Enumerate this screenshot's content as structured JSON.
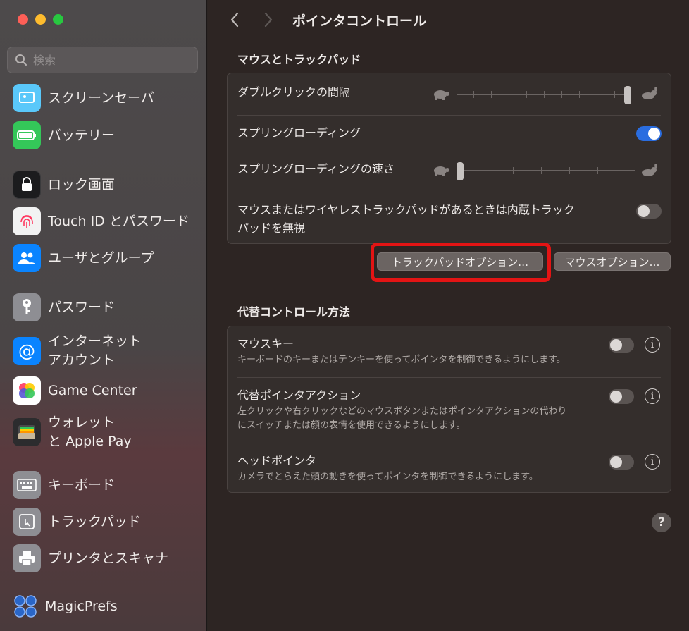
{
  "window": {
    "title": "ポインタコントロール"
  },
  "sidebar": {
    "search_placeholder": "検索",
    "items": [
      {
        "label": "スクリーンセーバ",
        "icon": "screensaver-icon",
        "color": "#5ac8fa"
      },
      {
        "label": "バッテリー",
        "icon": "battery-icon",
        "color": "#34c759"
      },
      {
        "label": "ロック画面",
        "icon": "lock-icon",
        "color": "#1c1c1e"
      },
      {
        "label": "Touch ID とパスワード",
        "icon": "fingerprint-icon",
        "color": "#f2f2f2"
      },
      {
        "label": "ユーザとグループ",
        "icon": "users-icon",
        "color": "#0a84ff"
      },
      {
        "label": "パスワード",
        "icon": "key-icon",
        "color": "#8e8e93"
      },
      {
        "label": "インターネット\nアカウント",
        "icon": "at-icon",
        "color": "#0a84ff"
      },
      {
        "label": "Game Center",
        "icon": "game-center-icon",
        "color": "#ffffff"
      },
      {
        "label": "ウォレット\nと Apple Pay",
        "icon": "wallet-icon",
        "color": "#2c2c2e"
      },
      {
        "label": "キーボード",
        "icon": "keyboard-icon",
        "color": "#8e8e93"
      },
      {
        "label": "トラックパッド",
        "icon": "trackpad-icon",
        "color": "#8e8e93"
      },
      {
        "label": "プリンタとスキャナ",
        "icon": "printer-icon",
        "color": "#8e8e93"
      },
      {
        "label": "MagicPrefs",
        "icon": "magicprefs-icon",
        "color": "#2a66c8"
      }
    ]
  },
  "sections": {
    "mouse_trackpad": {
      "title": "マウスとトラックパッド",
      "rows": {
        "double_click": {
          "label": "ダブルクリックの間隔",
          "slider_value": 1.0
        },
        "spring_loading": {
          "label": "スプリングローディング",
          "on": true
        },
        "spring_speed": {
          "label": "スプリングローディングの速さ",
          "slider_value": 0.0
        },
        "ignore_builtin": {
          "label": "マウスまたはワイヤレストラックパッドがあるときは内蔵トラック\nパッドを無視",
          "on": false
        }
      }
    },
    "buttons": {
      "trackpad_options": "トラックパッドオプション…",
      "mouse_options": "マウスオプション…"
    },
    "alt_control": {
      "title": "代替コントロール方法",
      "rows": {
        "mouse_keys": {
          "label": "マウスキー",
          "desc": "キーボードのキーまたはテンキーを使ってポインタを制御できるようにします。",
          "on": false
        },
        "alt_pointer": {
          "label": "代替ポインタアクション",
          "desc": "左クリックや右クリックなどのマウスボタンまたはポインタアクションの代わり\nにスイッチまたは顔の表情を使用できるようにします。",
          "on": false
        },
        "head_pointer": {
          "label": "ヘッドポインタ",
          "desc": "カメラでとらえた頭の動きを使ってポインタを制御できるようにします。",
          "on": false
        }
      }
    }
  },
  "help_label": "?",
  "info_label": "i",
  "colors": {
    "accent": "#2a6de0",
    "highlight": "#e31414"
  }
}
